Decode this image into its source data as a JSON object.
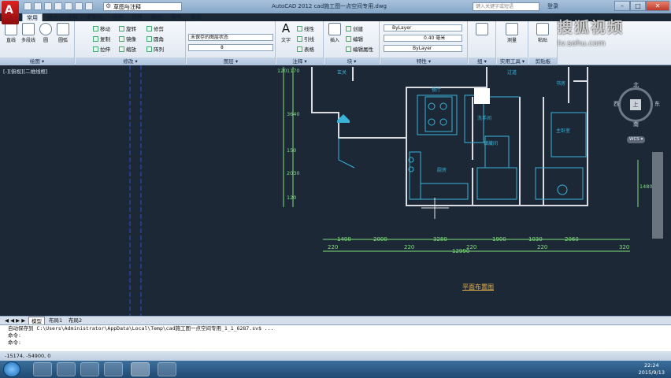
{
  "app": {
    "logo_letter": "A",
    "workspace": "草图与注释",
    "window_title": "AutoCAD 2012    cad施工图一点空间专用.dwg",
    "search_placeholder": "键入关键字或短语",
    "login": "登录",
    "win_min": "–",
    "win_max": "□",
    "win_close": "✕"
  },
  "tabs": [
    "常用",
    "插入",
    "注释",
    "参数化",
    "视图",
    "管理",
    "输出",
    "插件",
    "联机"
  ],
  "ribbon": {
    "draw": {
      "line": "直线",
      "polyline": "多段线",
      "circle": "圆",
      "arc": "圆弧",
      "label": "绘图 ▾"
    },
    "modify": {
      "move": "移动",
      "rotate": "旋转",
      "trim": "修剪",
      "copy": "复制",
      "mirror": "镜像",
      "fillet": "圆角",
      "stretch": "拉伸",
      "scale": "缩放",
      "array": "阵列",
      "label": "修改 ▾"
    },
    "layers": {
      "state": "未保存的图层状态",
      "current": "8",
      "label": "图层 ▾"
    },
    "annotation": {
      "text": "文字",
      "linear": "线性",
      "leader": "引线",
      "table": "表格",
      "label": "注释 ▾"
    },
    "block": {
      "insert": "插入",
      "create": "创建",
      "edit": "编辑",
      "attr": "编辑属性",
      "label": "块 ▾"
    },
    "properties": {
      "color": "ByLayer",
      "lineweight": "0.40 毫米",
      "linetype": "ByLayer",
      "label": "特性 ▾"
    },
    "groups": {
      "label": "组 ▾"
    },
    "utilities": {
      "measure": "测量",
      "label": "实用工具 ▾"
    },
    "clipboard": {
      "paste": "粘贴",
      "label": "剪贴板"
    }
  },
  "viewport": {
    "label": "[-][俯视][二维线框]",
    "plan_title": "平面布置图",
    "dims_bottom": [
      "1400",
      "2000",
      "3280",
      "1900",
      "1030",
      "2060"
    ],
    "dims_bottom2": [
      "220",
      "220",
      "220",
      "220",
      "320"
    ],
    "dim_total": "12990",
    "dims_left": [
      "1170",
      "3640",
      "150",
      "2030",
      "120"
    ],
    "dim_left_top": "120",
    "dim_right": "1480",
    "rooms": [
      "餐厅",
      "厨房",
      "洗手间",
      "主卧室",
      "书房",
      "储藏间",
      "玄关",
      "过道"
    ],
    "viewcube": {
      "n": "北",
      "s": "南",
      "e": "东",
      "w": "西",
      "top": "上",
      "wcs": "WCS ▾"
    }
  },
  "layout_tabs": {
    "nav": "◀ ◀ ▶ ▶",
    "model": "模型",
    "layout1": "布局1",
    "layout2": "布局2"
  },
  "command": {
    "line1": "自动保存到 C:\\Users\\Administrator\\AppData\\Local\\Temp\\cad施工图一点空间专用_1_1_6287.sv$ ...",
    "line2": "命令:",
    "line3": "命令:"
  },
  "status": {
    "coords": "-15174, -54900, 0"
  },
  "taskbar": {
    "time": "22:24",
    "date": "2015/9/13"
  },
  "watermark": {
    "brand": "搜狐视频",
    "url": "tv.sohu.com"
  },
  "colors": {
    "canvas": "#1c2836",
    "plan_lines": "#3bb3d8",
    "dims": "#7fe07a",
    "title": "#e8b34b",
    "walls": "#d9dde3"
  }
}
